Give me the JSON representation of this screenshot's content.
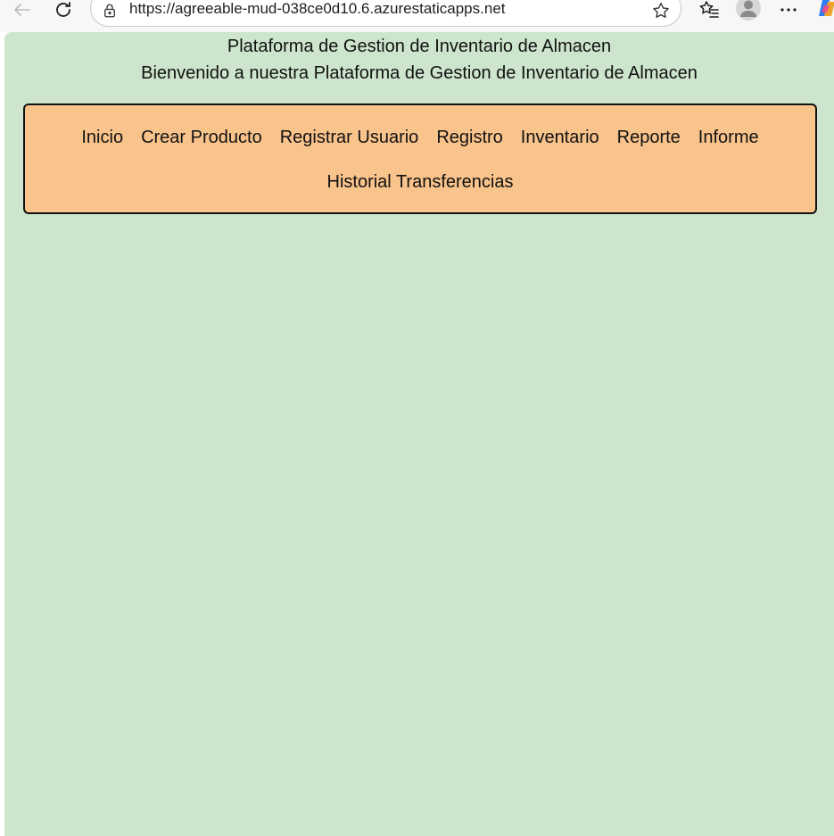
{
  "browser": {
    "url": "https://agreeable-mud-038ce0d10.6.azurestaticapps.net",
    "icons": {
      "back": "back-arrow-icon",
      "reload": "reload-icon",
      "lock": "lock-icon",
      "favorite": "star-icon",
      "favorites_list": "favorites-list-icon",
      "profile": "avatar-icon",
      "more": "more-icon",
      "copilot": "copilot-icon"
    }
  },
  "page": {
    "title": "Plataforma de Gestion de Inventario de Almacen",
    "subtitle": "Bienvenido a nuestra Plataforma de Gestion de Inventario de Almacen",
    "nav": {
      "items": [
        {
          "label": "Inicio"
        },
        {
          "label": "Crear Producto"
        },
        {
          "label": "Registrar Usuario"
        },
        {
          "label": "Registro"
        },
        {
          "label": "Inventario"
        },
        {
          "label": "Reporte"
        },
        {
          "label": "Informe"
        },
        {
          "label": "Historial Transferencias"
        }
      ]
    }
  },
  "colors": {
    "background": "#cce5cc",
    "nav_background": "#f9c38c",
    "nav_border": "#111111"
  }
}
